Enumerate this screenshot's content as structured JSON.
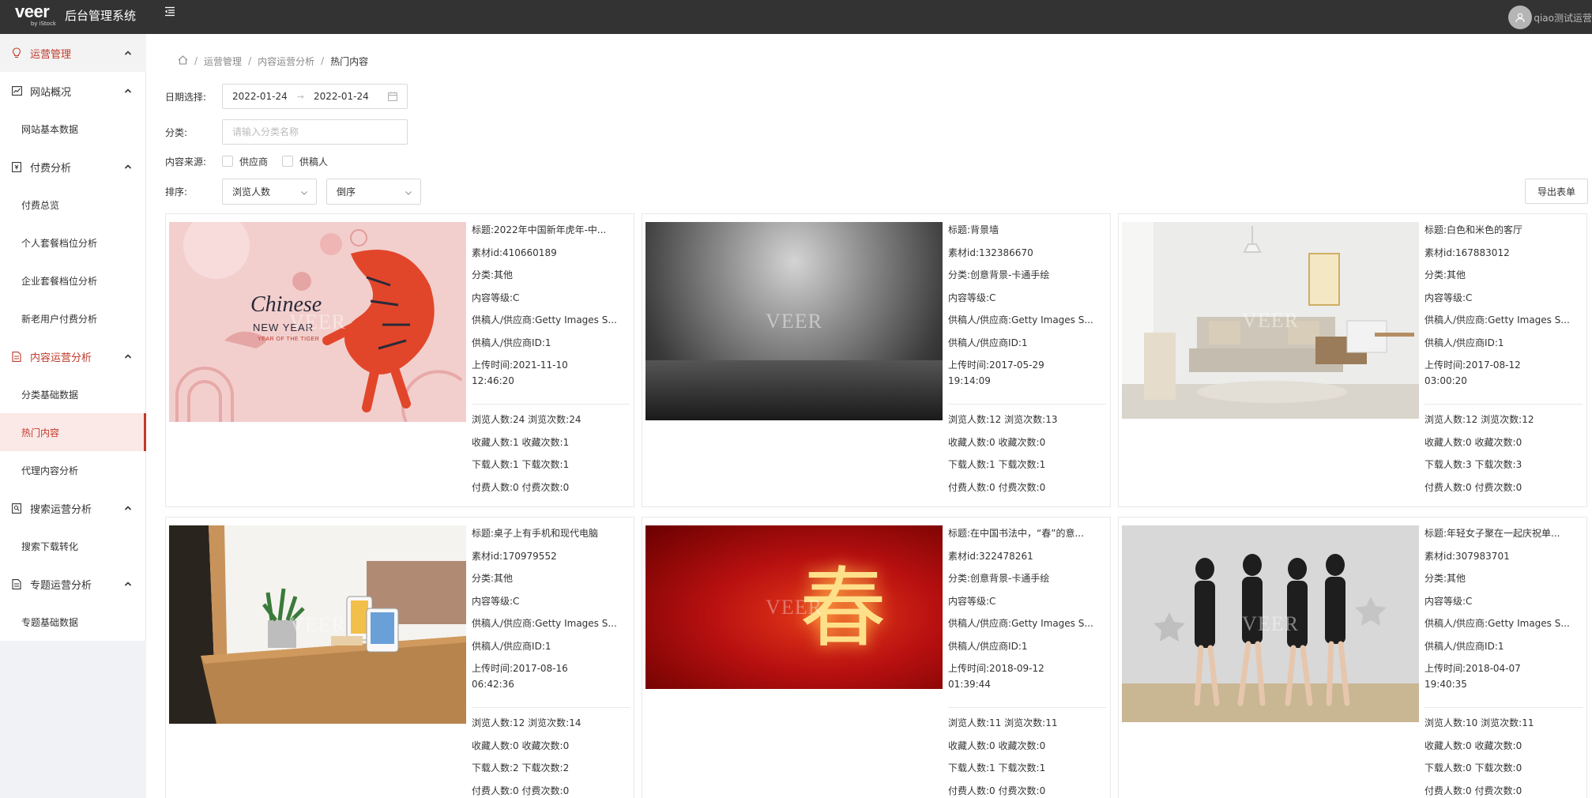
{
  "header": {
    "logo_main": "veer",
    "logo_sub": "by iStock",
    "app_title": "后台管理系统",
    "username": "qiao测试运营"
  },
  "sidebar": {
    "top_group": "运营管理",
    "groups": [
      {
        "label": "网站概况",
        "items": [
          "网站基本数据"
        ]
      },
      {
        "label": "付费分析",
        "items": [
          "付费总览",
          "个人套餐档位分析",
          "企业套餐档位分析",
          "新老用户付费分析"
        ]
      },
      {
        "label": "内容运营分析",
        "items": [
          "分类基础数据",
          "热门内容",
          "代理内容分析"
        ]
      },
      {
        "label": "搜索运营分析",
        "items": [
          "搜索下载转化"
        ]
      },
      {
        "label": "专题运营分析",
        "items": [
          "专题基础数据"
        ]
      }
    ]
  },
  "breadcrumb": [
    "运营管理",
    "内容运营分析",
    "热门内容"
  ],
  "filters": {
    "date_label": "日期选择:",
    "date_start": "2022-01-24",
    "date_end": "2022-01-24",
    "category_label": "分类:",
    "category_placeholder": "请输入分类名称",
    "source_label": "内容来源:",
    "source_options": [
      "供应商",
      "供稿人"
    ],
    "sort_label": "排序:",
    "sort_field": "浏览人数",
    "sort_order": "倒序",
    "export_label": "导出表单"
  },
  "labels": {
    "title": "标题:",
    "asset_id": "素材id:",
    "category": "分类:",
    "level": "内容等级:",
    "supplier": "供稿人/供应商:",
    "supplier_id": "供稿人/供应商ID:",
    "upload_time": "上传时间:",
    "views_people": "浏览人数:",
    "views_count": "浏览次数:",
    "fav_people": "收藏人数:",
    "fav_count": "收藏次数:",
    "dl_people": "下载人数:",
    "dl_count": "下载次数:",
    "pay_people": "付费人数:",
    "pay_count": "付费次数:"
  },
  "watermark": "VEER",
  "cards": [
    {
      "image": "chinese-new-year-tiger",
      "image_text_1": "Chinese",
      "image_text_2": "NEW YEAR",
      "image_text_3": "YEAR OF THE TIGER",
      "title": "2022年中国新年虎年-中...",
      "id": "410660189",
      "category": "其他",
      "level": "C",
      "supplier": "Getty Images S...",
      "supplier_id": "1",
      "upload_date": "2021-11-10",
      "upload_time": "12:46:20",
      "vp": "24",
      "vc": "24",
      "fp": "1",
      "fc": "1",
      "dp": "1",
      "dc": "1",
      "pp": "0",
      "pc": "0"
    },
    {
      "image": "concrete-wall-spotlight",
      "title": "背景墙",
      "id": "132386670",
      "category": "创意背景-卡通手绘",
      "level": "C",
      "supplier": "Getty Images S...",
      "supplier_id": "1",
      "upload_date": "2017-05-29",
      "upload_time": "19:14:09",
      "vp": "12",
      "vc": "13",
      "fp": "0",
      "fc": "0",
      "dp": "1",
      "dc": "1",
      "pp": "0",
      "pc": "0"
    },
    {
      "image": "white-beige-living-room",
      "title": "白色和米色的客厅",
      "id": "167883012",
      "category": "其他",
      "level": "C",
      "supplier": "Getty Images S...",
      "supplier_id": "1",
      "upload_date": "2017-08-12",
      "upload_time": "03:00:20",
      "vp": "12",
      "vc": "12",
      "fp": "0",
      "fc": "0",
      "dp": "3",
      "dc": "3",
      "pp": "0",
      "pc": "0"
    },
    {
      "image": "desk-phone-laptop",
      "title": "桌子上有手机和现代电脑",
      "id": "170979552",
      "category": "其他",
      "level": "C",
      "supplier": "Getty Images S...",
      "supplier_id": "1",
      "upload_date": "2017-08-16",
      "upload_time": "06:42:36",
      "vp": "12",
      "vc": "14",
      "fp": "0",
      "fc": "0",
      "dp": "2",
      "dc": "2",
      "pp": "0",
      "pc": "0"
    },
    {
      "image": "chinese-calligraphy-spring",
      "title": "在中国书法中，“春”的意...",
      "id": "322478261",
      "category": "创意背景-卡通手绘",
      "level": "C",
      "supplier": "Getty Images S...",
      "supplier_id": "1",
      "upload_date": "2018-09-12",
      "upload_time": "01:39:44",
      "vp": "11",
      "vc": "11",
      "fp": "0",
      "fc": "0",
      "dp": "1",
      "dc": "1",
      "pp": "0",
      "pc": "0"
    },
    {
      "image": "young-women-party",
      "title": "年轻女子聚在一起庆祝单...",
      "id": "307983701",
      "category": "其他",
      "level": "C",
      "supplier": "Getty Images S...",
      "supplier_id": "1",
      "upload_date": "2018-04-07",
      "upload_time": "19:40:35",
      "vp": "10",
      "vc": "11",
      "fp": "0",
      "fc": "0",
      "dp": "0",
      "dc": "0",
      "pp": "0",
      "pc": "0"
    }
  ]
}
